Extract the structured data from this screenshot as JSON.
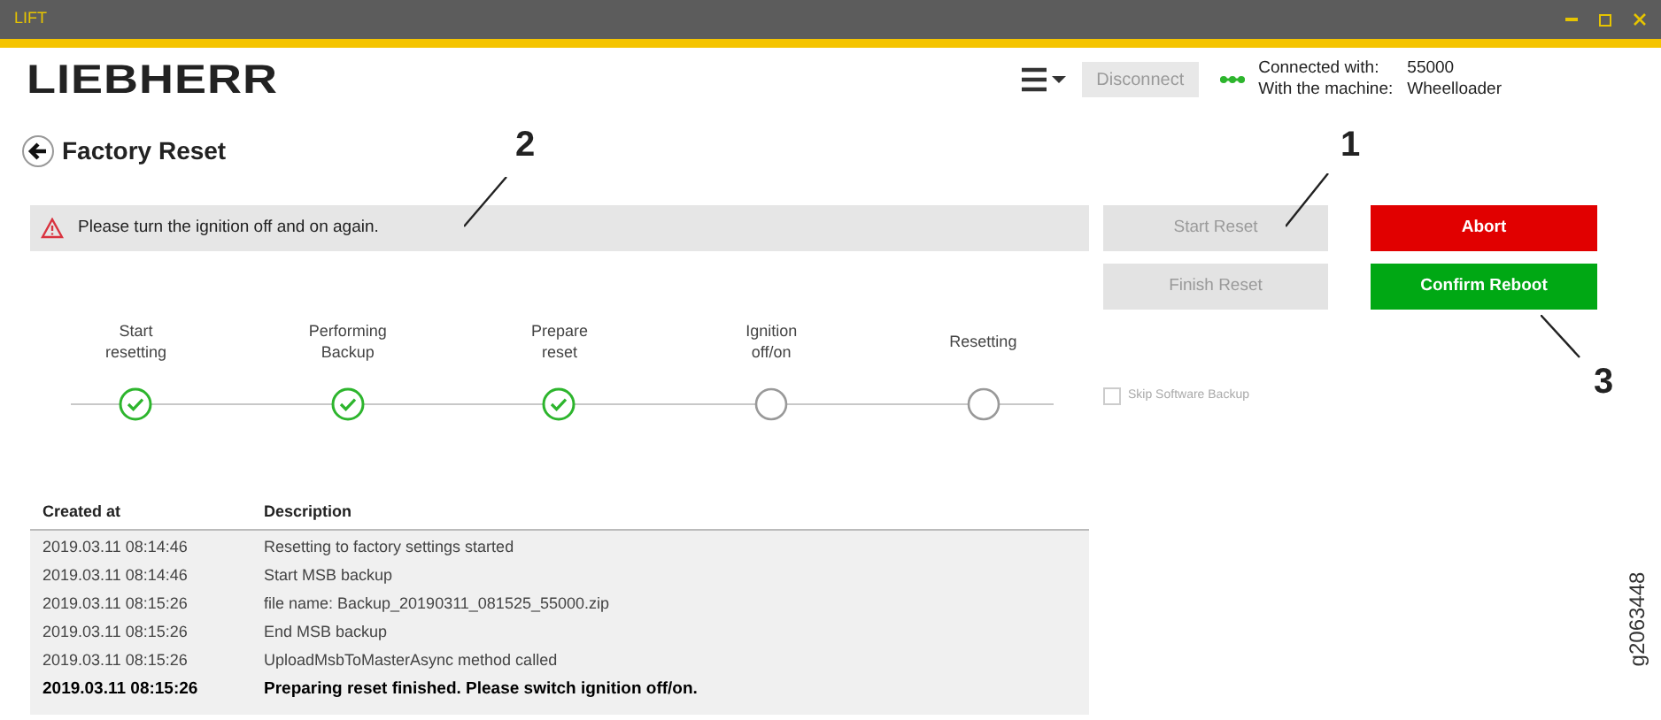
{
  "window": {
    "title": "LIFT"
  },
  "header": {
    "logo": "LIEBHERR",
    "disconnect": "Disconnect",
    "connected_label": "Connected with:",
    "connected_value": "55000",
    "machine_label": "With the machine:",
    "machine_value": "Wheelloader"
  },
  "page": {
    "title": "Factory Reset"
  },
  "message": {
    "text": "Please turn the ignition off and on again."
  },
  "buttons": [
    {
      "label": "Start Reset",
      "kind": "disabled"
    },
    {
      "label": "Abort",
      "kind": "danger"
    },
    {
      "label": "Finish Reset",
      "kind": "disabled"
    },
    {
      "label": "Confirm Reboot",
      "kind": "success"
    }
  ],
  "steps": [
    {
      "label": "Start resetting",
      "done": true
    },
    {
      "label": "Performing Backup",
      "done": true
    },
    {
      "label": "Prepare reset",
      "done": true
    },
    {
      "label": "Ignition off/on",
      "done": false
    },
    {
      "label": "Resetting",
      "done": false
    }
  ],
  "skip_backup": {
    "label": "Skip Software Backup",
    "checked": false
  },
  "table": {
    "columns": [
      "Created at",
      "Description"
    ],
    "rows": [
      {
        "created": "2019.03.11 08:14:46",
        "description": "Resetting to factory settings started",
        "emphasized": false
      },
      {
        "created": "2019.03.11 08:14:46",
        "description": "Start MSB backup",
        "emphasized": false
      },
      {
        "created": "2019.03.11 08:15:26",
        "description": "file name: Backup_20190311_081525_55000.zip",
        "emphasized": false
      },
      {
        "created": "2019.03.11 08:15:26",
        "description": "End MSB backup",
        "emphasized": false
      },
      {
        "created": "2019.03.11 08:15:26",
        "description": "UploadMsbToMasterAsync method called",
        "emphasized": false
      },
      {
        "created": "2019.03.11 08:15:26",
        "description": "Preparing reset finished. Please switch ignition off/on.",
        "emphasized": true
      }
    ]
  },
  "callouts": [
    "1",
    "2",
    "3"
  ],
  "figure_id": "g2063448"
}
